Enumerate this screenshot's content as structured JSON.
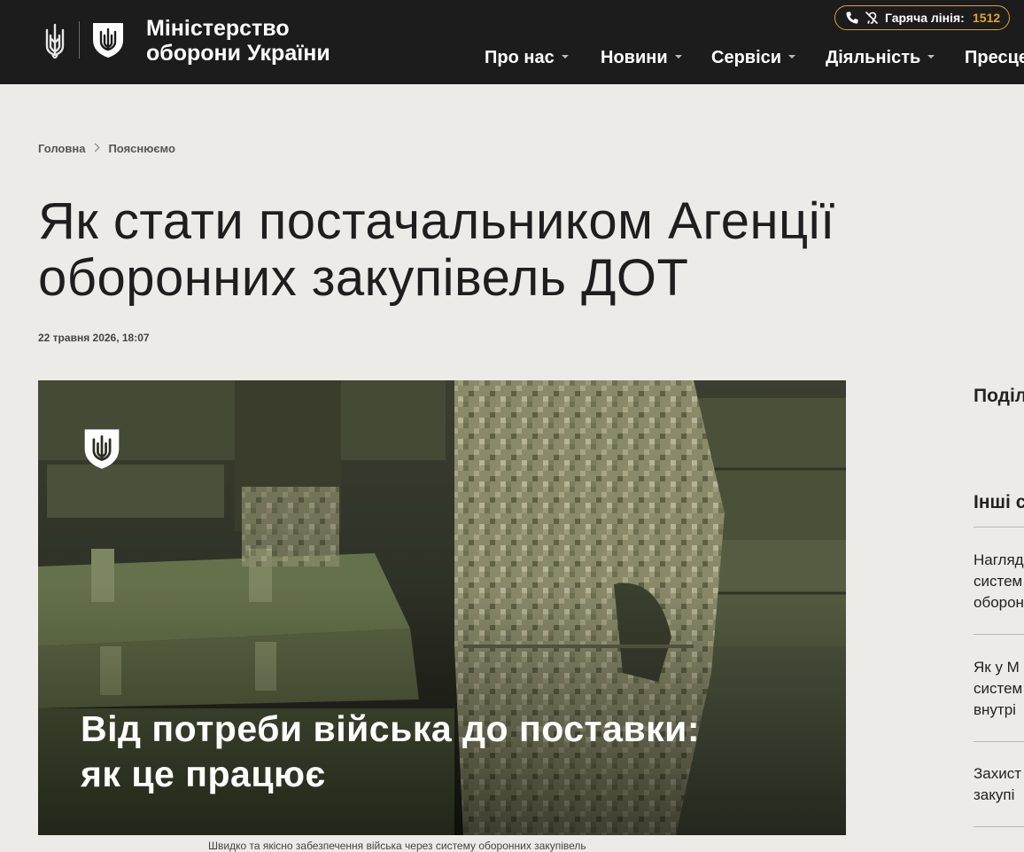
{
  "header": {
    "site_title_line1": "Міністерство",
    "site_title_line2": "оборони України",
    "hotline_label": "Гаряча лінія:",
    "hotline_number": "1512",
    "accent_color": "#d9a32a",
    "background_color": "#1c1c1c"
  },
  "nav": {
    "items": [
      {
        "label": "Про нас"
      },
      {
        "label": "Новини"
      },
      {
        "label": "Сервіси"
      },
      {
        "label": "Діяльність"
      },
      {
        "label": "Пресце"
      }
    ]
  },
  "breadcrumb": {
    "home": "Головна",
    "current": "Пояснюємо"
  },
  "article": {
    "title": "Як стати постачальником Агенції оборонних закупівель ДОТ",
    "date": "22 травня 2026, 18:07",
    "hero_caption_line1": "Від потреби війська до поставки:",
    "hero_caption_line2": "як це працює",
    "image_subcaption": "Швидко та якісно забезпечення війська через систему оборонних закупівель"
  },
  "sidebar": {
    "share_heading": "Поділ",
    "other_heading": "Інші с",
    "related": [
      {
        "line1": "Нагляд",
        "line2": "систем",
        "line3": "оборон"
      },
      {
        "line1": "Як у М",
        "line2": "систем",
        "line3": "внутрі"
      },
      {
        "line1": "Захист",
        "line2": "закупі"
      }
    ]
  },
  "icons": {
    "phone": "phone-icon",
    "hearing": "hearing-impaired-icon",
    "trident": "trident-icon",
    "shield": "mod-shield-icon"
  }
}
